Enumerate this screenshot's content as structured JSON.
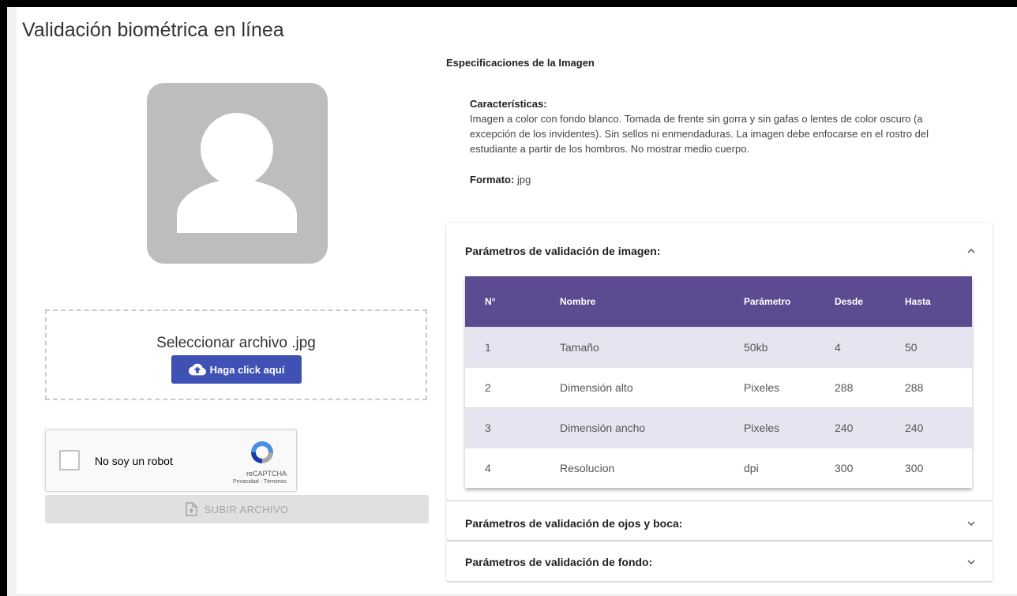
{
  "title": "Validación biométrica en línea",
  "upload": {
    "select_label": "Seleccionar archivo .jpg",
    "click_label": "Haga click aquí",
    "upload_label": "SUBIR ARCHIVO"
  },
  "captcha": {
    "label": "No soy un robot",
    "brand": "reCAPTCHA",
    "privacy": "Privacidad",
    "separator": " - ",
    "terms": "Términos"
  },
  "specs": {
    "title": "Especificaciones de la Imagen",
    "characteristics_label": "Características:",
    "characteristics_text": "Imagen a color con fondo blanco. Tomada de frente sin gorra y sin gafas o lentes de color oscuro (a excepción de los invidentes). Sin sellos ni enmendaduras. La imagen debe enfocarse en el rostro del estudiante a partir de los hombros. No mostrar medio cuerpo.",
    "format_label": "Formato:",
    "format_value": "jpg"
  },
  "panels": {
    "image": {
      "title": "Parámetros de validación de imagen:",
      "expanded": true,
      "columns": [
        "N°",
        "Nombre",
        "Parámetro",
        "Desde",
        "Hasta"
      ],
      "rows": [
        [
          "1",
          "Tamaño",
          "50kb",
          "4",
          "50"
        ],
        [
          "2",
          "Dimensión alto",
          "Pixeles",
          "288",
          "288"
        ],
        [
          "3",
          "Dimensión ancho",
          "Pixeles",
          "240",
          "240"
        ],
        [
          "4",
          "Resolucion",
          "dpi",
          "300",
          "300"
        ]
      ]
    },
    "eyes": {
      "title": "Parámetros de validación de ojos y boca:",
      "expanded": false
    },
    "background": {
      "title": "Parámetros de validación de fondo:",
      "expanded": false
    }
  },
  "colors": {
    "header_purple": "#5c4b91",
    "button_blue": "#3f51b5",
    "row_tint": "#e6e4f0"
  }
}
